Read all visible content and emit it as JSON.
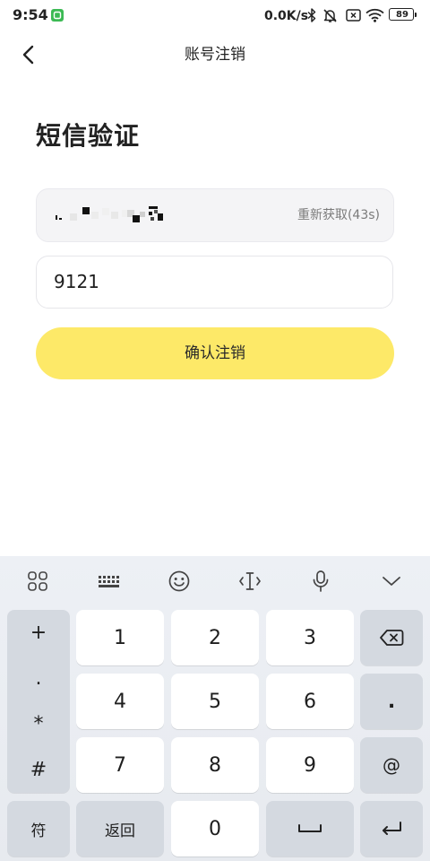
{
  "status_bar": {
    "time": "9:54",
    "net_speed": "0.0K/s",
    "battery_level": "89",
    "icons": [
      "app-notification-icon",
      "bluetooth-icon",
      "bell-off-icon",
      "sim-x-icon",
      "wifi-icon",
      "battery-icon"
    ]
  },
  "header": {
    "back_icon": "chevron-left-icon",
    "title": "账号注销"
  },
  "page": {
    "heading": "短信验证"
  },
  "phone_field": {
    "resend_label": "重新获取(43s)"
  },
  "code_field": {
    "value": "9121"
  },
  "confirm_button": {
    "label": "确认注销"
  },
  "keyboard": {
    "toolbar_icons": [
      "apps-grid-icon",
      "keyboard-icon",
      "emoji-icon",
      "cursor-move-icon",
      "microphone-icon",
      "chevron-down-icon"
    ],
    "symbol_column": [
      "+",
      ".",
      "*",
      "#"
    ],
    "digits": [
      "1",
      "2",
      "3",
      "4",
      "5",
      "6",
      "7",
      "8",
      "9"
    ],
    "zero": "0",
    "dot_key": ".",
    "at_key": "@",
    "symbols_key": "符",
    "return_key": "返回",
    "function_icons": [
      "backspace-icon",
      "space-icon",
      "enter-icon"
    ]
  },
  "colors": {
    "accent": "#fde968",
    "keyboard_bg": "#eaedf2",
    "key_white": "#ffffff",
    "key_gray": "#d4d9e0",
    "text": "#222222",
    "muted": "#7b7b7b",
    "app_icon_green": "#3cba54"
  }
}
